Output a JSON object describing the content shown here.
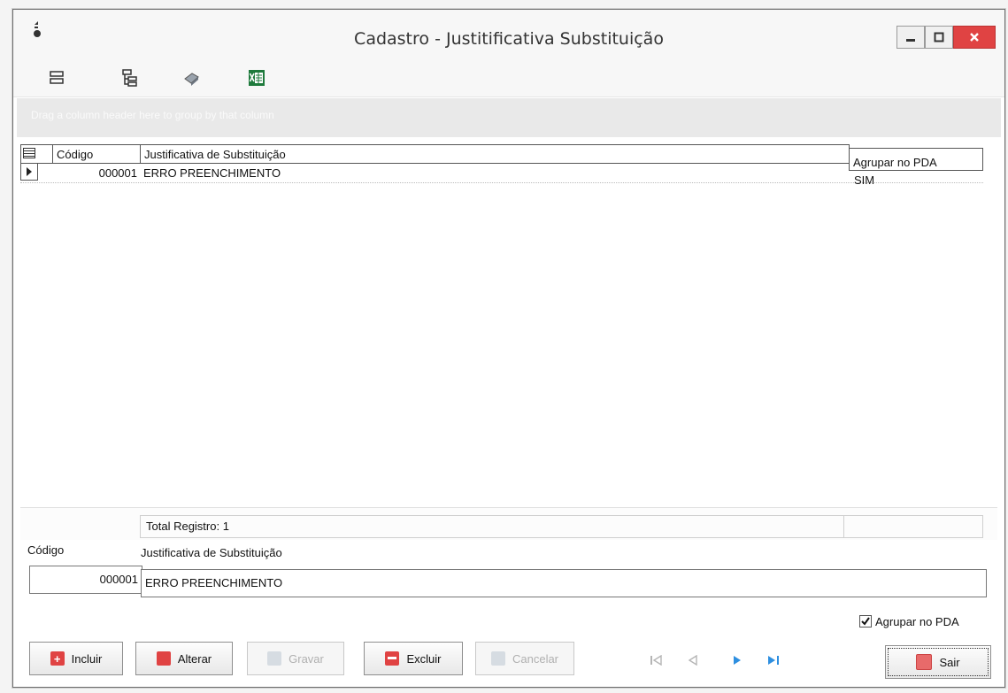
{
  "window": {
    "title": "Cadastro - Justitificativa Substituição",
    "controls": [
      "minimize",
      "maximize",
      "close"
    ]
  },
  "toolbar": {
    "icons": [
      "group-rows-icon",
      "tree-layout-icon",
      "print-icon",
      "excel-export-icon"
    ]
  },
  "group_panel": {
    "hint": "Drag a column header here to group by that column"
  },
  "grid": {
    "columns": [
      "Código",
      "Justificativa de Substituição",
      "Agrupar no PDA"
    ],
    "rows": [
      {
        "codigo": "000001",
        "justificativa": "ERRO PREENCHIMENTO",
        "agrupar": "SIM"
      }
    ],
    "footer_total": "Total Registro: 1"
  },
  "form": {
    "codigo_label": "Código",
    "codigo_value": "000001",
    "justificativa_label": "Justificativa de Substituição",
    "justificativa_value": "ERRO PREENCHIMENTO",
    "agrupar_label": "Agrupar no PDA",
    "agrupar_checked": true
  },
  "buttons": {
    "incluir": "Incluir",
    "alterar": "Alterar",
    "gravar": "Gravar",
    "excluir": "Excluir",
    "cancelar": "Cancelar",
    "sair": "Sair"
  },
  "colors": {
    "accent_red": "#e04343",
    "nav_blue": "#2e8fe0",
    "disabled_text": "#b0b0b0"
  }
}
